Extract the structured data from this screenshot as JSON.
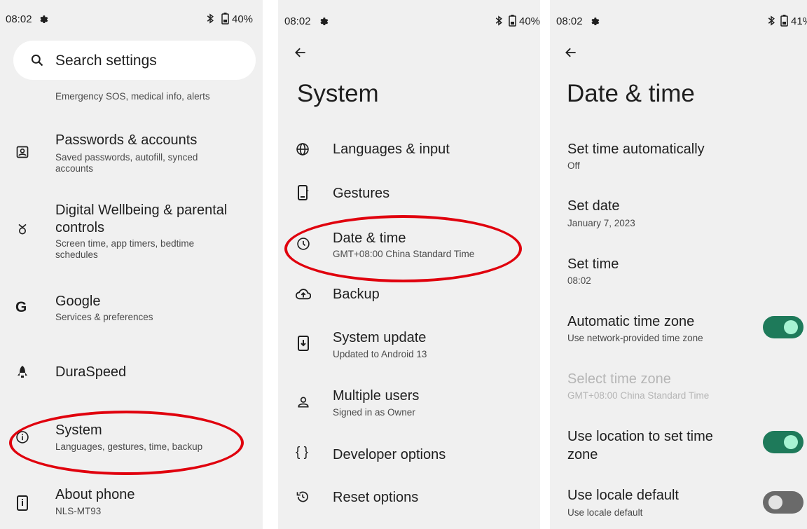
{
  "panel1": {
    "status": {
      "time": "08:02",
      "battery": "40%"
    },
    "search": {
      "placeholder": "Search settings"
    },
    "partial_subtitle": "Emergency SOS, medical info, alerts",
    "items": [
      {
        "title": "Passwords & accounts",
        "sub": "Saved passwords, autofill, synced accounts",
        "icon": "account-box-icon"
      },
      {
        "title": "Digital Wellbeing & parental controls",
        "sub": "Screen time, app timers, bedtime schedules",
        "icon": "wellbeing-icon"
      },
      {
        "title": "Google",
        "sub": "Services & preferences",
        "icon": "google-icon"
      },
      {
        "title": "DuraSpeed",
        "sub": "",
        "icon": "rocket-icon"
      },
      {
        "title": "System",
        "sub": "Languages, gestures, time, backup",
        "icon": "info-icon"
      },
      {
        "title": "About phone",
        "sub": "NLS-MT93",
        "icon": "phone-icon"
      }
    ]
  },
  "panel2": {
    "status": {
      "time": "08:02",
      "battery": "40%"
    },
    "page_title": "System",
    "items": [
      {
        "title": "Languages & input",
        "sub": "",
        "icon": "globe-icon"
      },
      {
        "title": "Gestures",
        "sub": "",
        "icon": "gesture-phone-icon"
      },
      {
        "title": "Date & time",
        "sub": "GMT+08:00 China Standard Time",
        "icon": "clock-icon"
      },
      {
        "title": "Backup",
        "sub": "",
        "icon": "cloud-upload-icon"
      },
      {
        "title": "System update",
        "sub": "Updated to Android 13",
        "icon": "system-update-icon"
      },
      {
        "title": "Multiple users",
        "sub": "Signed in as Owner",
        "icon": "person-icon"
      },
      {
        "title": "Developer options",
        "sub": "",
        "icon": "braces-icon"
      },
      {
        "title": "Reset options",
        "sub": "",
        "icon": "history-icon"
      }
    ]
  },
  "panel3": {
    "status": {
      "time": "08:02",
      "battery": "41%"
    },
    "page_title": "Date & time",
    "items": [
      {
        "title": "Set time automatically",
        "sub": "Off"
      },
      {
        "title": "Set date",
        "sub": "January 7, 2023"
      },
      {
        "title": "Set time",
        "sub": "08:02"
      },
      {
        "title": "Automatic time zone",
        "sub": "Use network-provided time zone",
        "toggle": "on"
      },
      {
        "title": "Select time zone",
        "sub": "GMT+08:00 China Standard Time",
        "disabled": true
      },
      {
        "title": "Use location to set time zone",
        "sub": "",
        "toggle": "on"
      },
      {
        "title": "Use locale default",
        "sub": "Use locale default",
        "toggle": "off"
      }
    ]
  },
  "colors": {
    "background": "#f0f0f0",
    "toggle_on": "#1e7a5a",
    "toggle_off": "#6a6a6a",
    "highlight": "#e0000d"
  }
}
